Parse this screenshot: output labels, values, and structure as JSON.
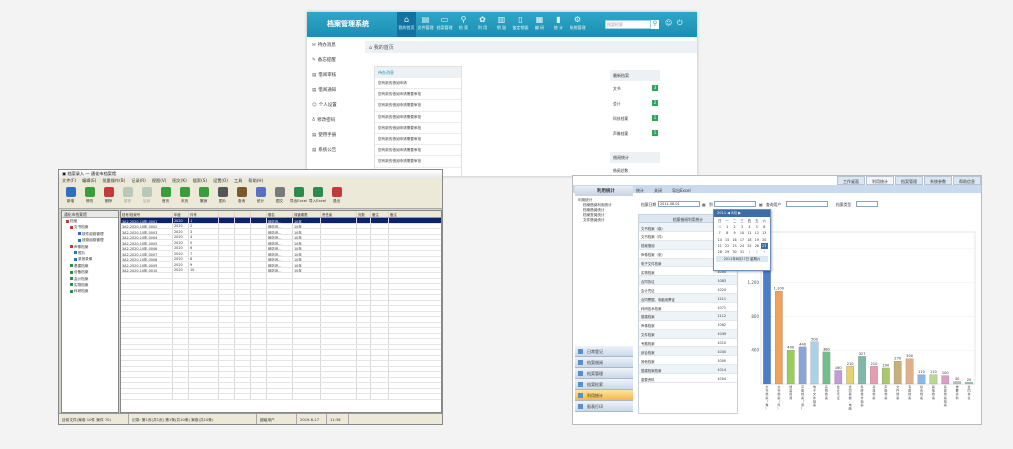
{
  "web_app": {
    "logo": "档案管理系统",
    "nav": [
      {
        "label": "我的首页",
        "icon": "home-icon",
        "glyph": "⌂"
      },
      {
        "label": "文件管理",
        "icon": "file-icon",
        "glyph": "▤"
      },
      {
        "label": "档案管理",
        "icon": "folder-icon",
        "glyph": "▭"
      },
      {
        "label": "检 索",
        "icon": "search-icon",
        "glyph": "⚲"
      },
      {
        "label": "利 用",
        "icon": "gear-icon",
        "glyph": "✿"
      },
      {
        "label": "销 毁",
        "icon": "trash-icon",
        "glyph": "▥"
      },
      {
        "label": "鉴定销毁",
        "icon": "document-icon",
        "glyph": "▯"
      },
      {
        "label": "编 研",
        "icon": "book-icon",
        "glyph": "▦"
      },
      {
        "label": "统 计",
        "icon": "chart-icon",
        "glyph": "▮"
      },
      {
        "label": "系统管理",
        "icon": "settings-icon",
        "glyph": "⚙"
      }
    ],
    "search_placeholder": "档案检索",
    "sidebar": [
      {
        "label": "待办消息",
        "glyph": "✉"
      },
      {
        "label": "备忘提醒",
        "glyph": "✎"
      },
      {
        "label": "借阅审核",
        "glyph": "▤"
      },
      {
        "label": "借阅通知",
        "glyph": "▤"
      },
      {
        "label": "个人设置",
        "glyph": "☺"
      },
      {
        "label": "修改密码",
        "glyph": "♁"
      },
      {
        "label": "使用手册",
        "glyph": "▤"
      },
      {
        "label": "系统公告",
        "glyph": "▤"
      }
    ],
    "breadcrumb": "我的首页",
    "panel_title": "待办消息",
    "panel_rows": [
      "您有新的借阅申请",
      "您有新的借阅申请需要审批",
      "您有新的借阅申请需要审批",
      "您有新的借阅申请需要审批",
      "您有新的借阅申请需要审批",
      "您有新的借阅申请需要审批",
      "您有新的借阅申请需要审批",
      "您有新的借阅申请需要审批",
      "您有新的借阅申请需要审批"
    ],
    "right_panel_title": "最新档案",
    "right_rows": [
      {
        "label": "文书",
        "badge": "3"
      },
      {
        "label": "会计",
        "badge": "2"
      },
      {
        "label": "科技档案",
        "badge": "1"
      },
      {
        "label": "声像档案",
        "badge": "1"
      }
    ],
    "right_panel2_title": "借阅统计",
    "right_panel2_row": "借阅总数"
  },
  "desktop_app": {
    "title": "档案录入 — 通化市档案馆",
    "menu": [
      "文件(F)",
      "编辑(E)",
      "批量操作(B)",
      "记录(R)",
      "视图(V)",
      "图文(K)",
      "搜索(S)",
      "设置(O)",
      "工具",
      "帮助(H)"
    ],
    "toolbar": [
      {
        "label": "新增",
        "color": "#2e6fc4",
        "disabled": false
      },
      {
        "label": "修改",
        "color": "#3a9c3a",
        "disabled": false
      },
      {
        "label": "删除",
        "color": "#c43a3a",
        "disabled": false
      },
      {
        "label": "前页",
        "color": "#3a9c3a",
        "disabled": true
      },
      {
        "label": "后页",
        "color": "#3a9c3a",
        "disabled": true
      },
      {
        "label": "首页",
        "color": "#3a9c3a",
        "disabled": false
      },
      {
        "label": "末页",
        "color": "#3a9c3a",
        "disabled": false
      },
      {
        "label": "撤销",
        "color": "#3a9c3a",
        "disabled": false
      },
      {
        "label": "图片",
        "color": "#555555",
        "disabled": false
      },
      {
        "label": "查询",
        "color": "#7a5a2a",
        "disabled": false
      },
      {
        "label": "统计",
        "color": "#5a6ec4",
        "disabled": false
      },
      {
        "label": "图文",
        "color": "#7a7a7a",
        "disabled": false
      },
      {
        "label": "导出Excel",
        "color": "#2e8a4e",
        "disabled": false
      },
      {
        "label": "导入Excel",
        "color": "#2e8a4e",
        "disabled": false
      },
      {
        "label": "退出",
        "color": "#c43a3a",
        "disabled": false
      }
    ],
    "tree_header": "通化市档案馆",
    "tree": [
      {
        "label": "档案",
        "indent": 1,
        "color": "#c43a3a"
      },
      {
        "label": "文书档案",
        "indent": 2,
        "color": "#c43a3a"
      },
      {
        "label": "按件组卷管理",
        "indent": 4,
        "color": "#2e6fc4"
      },
      {
        "label": "按卷组卷管理",
        "indent": 4,
        "color": "#2e6fc4"
      },
      {
        "label": "声像档案",
        "indent": 2,
        "color": "#c43a3a"
      },
      {
        "label": "照片",
        "indent": 3,
        "color": "#2e6fc4"
      },
      {
        "label": "录音录像",
        "indent": 3,
        "color": "#2e6fc4"
      },
      {
        "label": "基建档案",
        "indent": 2,
        "color": "#2e8a4e"
      },
      {
        "label": "设备档案",
        "indent": 2,
        "color": "#2e8a4e"
      },
      {
        "label": "会计档案",
        "indent": 2,
        "color": "#2e8a4e"
      },
      {
        "label": "实物档案",
        "indent": 2,
        "color": "#2e8a4e"
      },
      {
        "label": "科研档案",
        "indent": 2,
        "color": "#2e8a4e"
      }
    ],
    "columns": [
      "档号/档案号",
      "年度",
      "件号",
      "",
      "",
      "",
      "题名",
      "保管期限",
      "责任者",
      "页数",
      "备注",
      "备注"
    ],
    "rows": [
      [
        "3A2-2020-10年-0001",
        "2020",
        "1",
        "",
        "",
        "",
        "网站设…",
        "10年",
        "",
        "",
        "",
        ""
      ],
      [
        "3A2-2020-10年-0002",
        "2020",
        "2",
        "",
        "",
        "",
        "网站设…",
        "10年",
        "",
        "",
        "",
        ""
      ],
      [
        "3A2-2020-10年-0003",
        "2020",
        "3",
        "",
        "",
        "",
        "网站设…",
        "10年",
        "",
        "",
        "",
        ""
      ],
      [
        "3A2-2020-10年-0004",
        "2020",
        "4",
        "",
        "",
        "",
        "网站设…",
        "10年",
        "",
        "",
        "",
        ""
      ],
      [
        "3A2-2020-10年-0005",
        "2020",
        "5",
        "",
        "",
        "",
        "网站设…",
        "10年",
        "",
        "",
        "",
        ""
      ],
      [
        "3A2-2020-10年-0006",
        "2020",
        "6",
        "",
        "",
        "",
        "网站设…",
        "10年",
        "",
        "",
        "",
        ""
      ],
      [
        "3A2-2020-10年-0007",
        "2020",
        "7",
        "",
        "",
        "",
        "网站设…",
        "10年",
        "",
        "",
        "",
        ""
      ],
      [
        "3A2-2020-10年-0008",
        "2020",
        "8",
        "",
        "",
        "",
        "网站设…",
        "10年",
        "",
        "",
        "",
        ""
      ],
      [
        "3A2-2020-10年-0009",
        "2020",
        "9",
        "",
        "",
        "",
        "网站设…",
        "10年",
        "",
        "",
        "",
        ""
      ],
      [
        "3A2-2020-10年-0010",
        "2020",
        "10",
        "",
        "",
        "",
        "网站设…",
        "10年",
        "",
        "",
        "",
        ""
      ]
    ],
    "status": [
      "目前文件(案卷 10件  案件 70)",
      "记录: 第1页(共1页)  第1条(共10条)  案卷(共10条)",
      "超级用户",
      "2019-6-17",
      "11:36"
    ]
  },
  "stats_app": {
    "tabs": [
      "工作桌面",
      "利用统计",
      "档案管理",
      "系统参数",
      "帮助信息"
    ],
    "active_tab": 1,
    "title": "利用统计",
    "query_bar": [
      "统计",
      "关闭",
      "导出Excel"
    ],
    "tree": [
      "利用统计",
      "档案借阅利用统计",
      "档案借阅统计",
      "档案查阅统计",
      "文件借阅统计"
    ],
    "left_nav": [
      "日常登记",
      "档案借阅",
      "档案管理",
      "档案检索",
      "利用统计",
      "报表打印"
    ],
    "active_nav": 4,
    "criteria": {
      "date_label": "档案日期",
      "date_from": "2011-08-01",
      "to": "到",
      "query_user": "查询用户",
      "type_label": "档案类型"
    },
    "table_title": "档案借阅利用统计",
    "table_rows": [
      [
        "文书档案（卷）",
        "1089"
      ],
      [
        "文书档案（件）",
        "1183"
      ],
      [
        "档案借阅",
        "1484"
      ],
      [
        "声像档案（张）",
        "1489"
      ],
      [
        "电子文件档案",
        "1184"
      ],
      [
        "实物档案",
        "1000"
      ],
      [
        "合同协议",
        "1083"
      ],
      [
        "会计凭证",
        "1024"
      ],
      [
        "合同票据、电脑用票证",
        "1211"
      ],
      [
        "科研技术档案",
        "1071"
      ],
      [
        "基建档案",
        "1112"
      ],
      [
        "声像档案",
        "1082"
      ],
      [
        "文件档案",
        "1049"
      ],
      [
        "专题档案",
        "1010"
      ],
      [
        "综合档案",
        "1040"
      ],
      [
        "其他档案",
        "1000"
      ],
      [
        "基建档案档案",
        "1014"
      ],
      [
        "重要资料",
        "1004"
      ]
    ],
    "calendar": {
      "header": "2011 ◀ 8月 ▶",
      "weekdays": [
        "日",
        "一",
        "二",
        "三",
        "四",
        "五",
        "六"
      ],
      "days": [
        "31",
        "1",
        "2",
        "3",
        "4",
        "5",
        "6",
        "7",
        "8",
        "9",
        "10",
        "11",
        "12",
        "13",
        "14",
        "15",
        "16",
        "17",
        "18",
        "19",
        "20",
        "21",
        "22",
        "23",
        "24",
        "25",
        "26",
        "27",
        "28",
        "29",
        "30",
        "31",
        "1",
        "2",
        "3"
      ],
      "footer": "2011年8月27日 星期六"
    }
  },
  "chart_data": {
    "type": "bar",
    "yaxis_ticks": [
      "1,600",
      "1,200",
      "800",
      "400"
    ],
    "categories": [
      "文书档案（卷）",
      "文书档案（件）",
      "档案借阅",
      "声像档案（张）",
      "电子文件档案",
      "实物档案",
      "会计凭证",
      "合同票据、电脑用票证",
      "科研技术档案",
      "基建档案",
      "声像档案",
      "文件档案",
      "专题档案",
      "综合档案",
      "其他档案",
      "基建档案档案",
      "重要资料",
      "合同协议"
    ],
    "values": [
      1700,
      1100,
      400,
      440,
      500,
      380,
      160,
      210,
      327,
      210,
      190,
      270,
      300,
      110,
      110,
      100,
      30,
      20
    ],
    "value_labels": [
      "",
      "1,100",
      "400",
      "440",
      "500",
      "380",
      "160",
      "210",
      "327",
      "210",
      "190",
      "270",
      "300",
      "110",
      "110",
      "100",
      "30",
      "20"
    ],
    "colors": [
      "#4a7ec8",
      "#f0a25a",
      "#9acd5a",
      "#8aa6d8",
      "#a6d4e6",
      "#6fbf8a",
      "#c49ad8",
      "#e8d06a",
      "#7fb8a8",
      "#e89ab0",
      "#a8c86a",
      "#c8b07a",
      "#e0b08a",
      "#8ab8e0",
      "#b8d890",
      "#d8a0c8",
      "#c0c0c0",
      "#90c8c0"
    ]
  }
}
